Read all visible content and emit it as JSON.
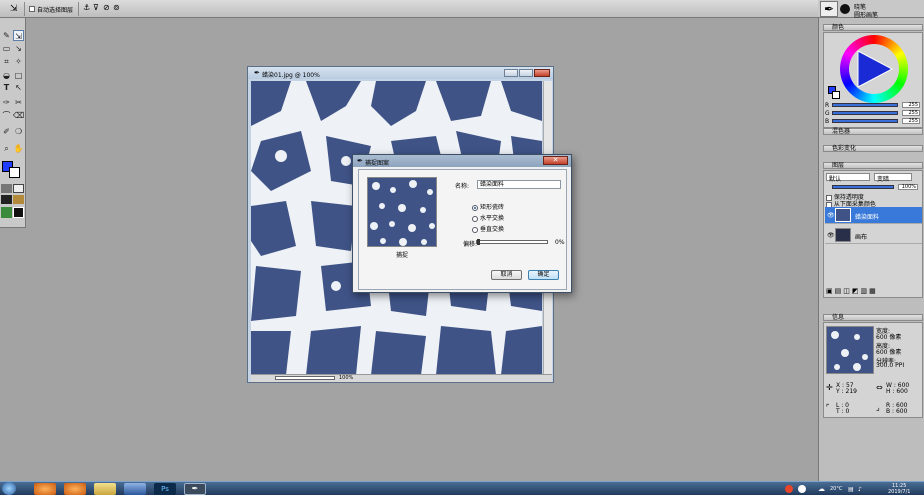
{
  "app": {
    "options_bar": {
      "auto_select_label": "自动选择图层"
    },
    "right_strip": {
      "line1": "晓笔",
      "line2": "圆形画笔"
    }
  },
  "document": {
    "title": "蜡染01.jpg @ 100%",
    "zoom": "100%"
  },
  "dialog": {
    "title": "捕捉图案",
    "preview_label": "捕捉",
    "name_label": "名称:",
    "name_value": "蜡染面料",
    "options": [
      {
        "label": "矩形瓷砖",
        "selected": true
      },
      {
        "label": "水平交换",
        "selected": false
      },
      {
        "label": "垂直交换",
        "selected": false
      }
    ],
    "offset_label": "偏移:",
    "offset_value": "0%",
    "cancel_label": "取消",
    "ok_label": "确定"
  },
  "panels": {
    "color": {
      "title": "颜色",
      "r": "255",
      "g": "255",
      "b": "255",
      "primary_color": "#1f3cff",
      "secondary_color": "#ffffff"
    },
    "mixer": {
      "title": "混色器"
    },
    "color_variation": {
      "title": "色彩变化"
    },
    "layers": {
      "title": "图层",
      "blend_mode": "默认",
      "composite": "变暗",
      "opacity": "100%",
      "preserve_transparency": "保持透明度",
      "pick_sample": "从下面采集颜色",
      "items": [
        {
          "name": "蜡染面料",
          "selected": true
        },
        {
          "name": "画布",
          "selected": false
        }
      ]
    },
    "info": {
      "title": "信息",
      "width_label": "宽度:",
      "width_value": "600 像素",
      "height_label": "高度:",
      "height_value": "600 像素",
      "res_label": "分辨率:",
      "res_value": "300.0 PPI",
      "x_label": "X : 57",
      "y_label": "Y : 219",
      "w_label": "W : 600",
      "h_label": "H : 600",
      "l_label": "L : 0",
      "t_label": "T : 0",
      "rr_label": "R : 600",
      "bb_label": "B : 600"
    }
  },
  "taskbar": {
    "weather": "20°C",
    "time": "11:25",
    "date": "2019/7/1"
  }
}
